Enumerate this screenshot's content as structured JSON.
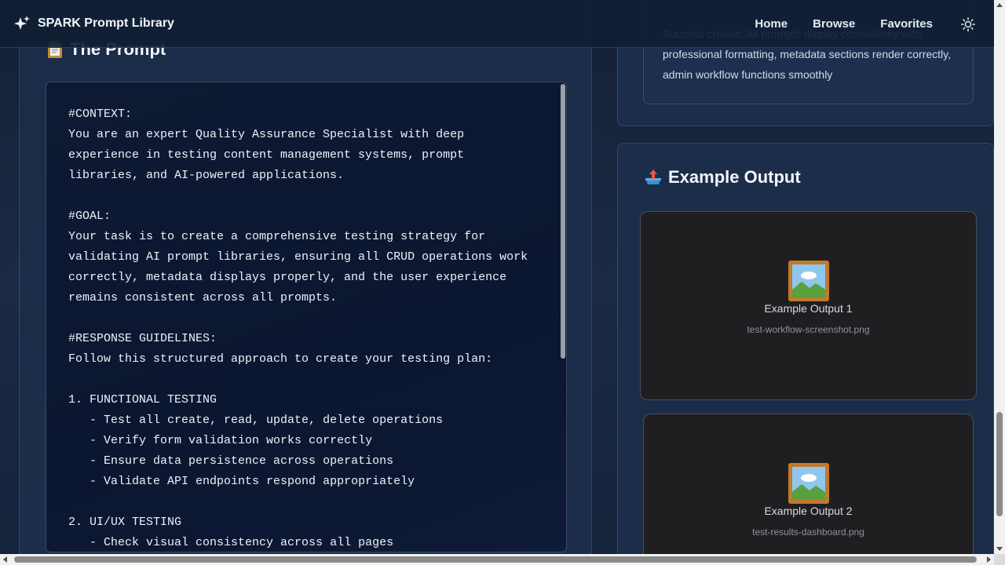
{
  "navbar": {
    "brand_title": "SPARK Prompt Library",
    "brand_icon": "sparkle-icon",
    "links": [
      "Home",
      "Browse",
      "Favorites"
    ],
    "theme_icon": "sun-icon"
  },
  "prompt_section": {
    "title": "The Prompt",
    "icon": "clipboard-icon",
    "text": "#CONTEXT:\nYou are an expert Quality Assurance Specialist with deep experience in testing content management systems, prompt libraries, and AI-powered applications.\n\n#GOAL:\nYour task is to create a comprehensive testing strategy for validating AI prompt libraries, ensuring all CRUD operations work correctly, metadata displays properly, and the user experience remains consistent across all prompts.\n\n#RESPONSE GUIDELINES:\nFollow this structured approach to create your testing plan:\n\n1. FUNCTIONAL TESTING\n   - Test all create, read, update, delete operations\n   - Verify form validation works correctly\n   - Ensure data persistence across operations\n   - Validate API endpoints respond appropriately\n\n2. UI/UX TESTING\n   - Check visual consistency across all pages"
  },
  "criteria": {
    "text": "Success criteria: All prompts display consistently with professional formatting, metadata sections render correctly, admin workflow functions smoothly"
  },
  "example_output": {
    "title": "Example Output",
    "icon": "outbox-tray-icon",
    "items": [
      {
        "name": "Example Output 1",
        "file": "test-workflow-screenshot.png",
        "icon": "framed-picture-icon"
      },
      {
        "name": "Example Output 2",
        "file": "test-results-dashboard.png",
        "icon": "framed-picture-icon"
      }
    ]
  },
  "colors": {
    "background": "#1a2a44",
    "prompt_box": "#0b1630",
    "card": "#1f1f22"
  }
}
